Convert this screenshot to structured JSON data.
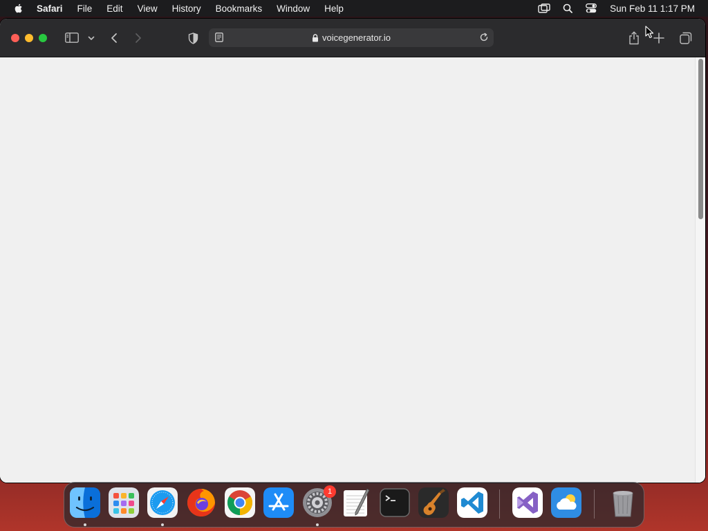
{
  "menubar": {
    "app_name": "Safari",
    "items": [
      "File",
      "Edit",
      "View",
      "History",
      "Bookmarks",
      "Window",
      "Help"
    ],
    "clock": "Sun Feb 11  1:17 PM",
    "status_icons": [
      "screen-mirroring-icon",
      "spotlight-search-icon",
      "control-center-icon"
    ]
  },
  "window": {
    "url": "voicegenerator.io",
    "page_loaded": false
  },
  "dock": {
    "apps": [
      "Finder",
      "Launchpad",
      "Safari",
      "Firefox",
      "Google Chrome",
      "App Store",
      "System Settings",
      "TextEdit",
      "Terminal",
      "GarageBand",
      "Visual Studio Code",
      "Visual Studio",
      "Cloud App",
      "Trash"
    ],
    "running": [
      "Finder",
      "Safari",
      "System Settings"
    ],
    "settings_badge": "1"
  },
  "colors": {
    "menubar": "#1c1c1e",
    "toolbar": "#2b2b2d",
    "content": "#f0f0f0",
    "close": "#fe5f57",
    "minimize": "#febc2e",
    "maximize": "#28c840"
  }
}
